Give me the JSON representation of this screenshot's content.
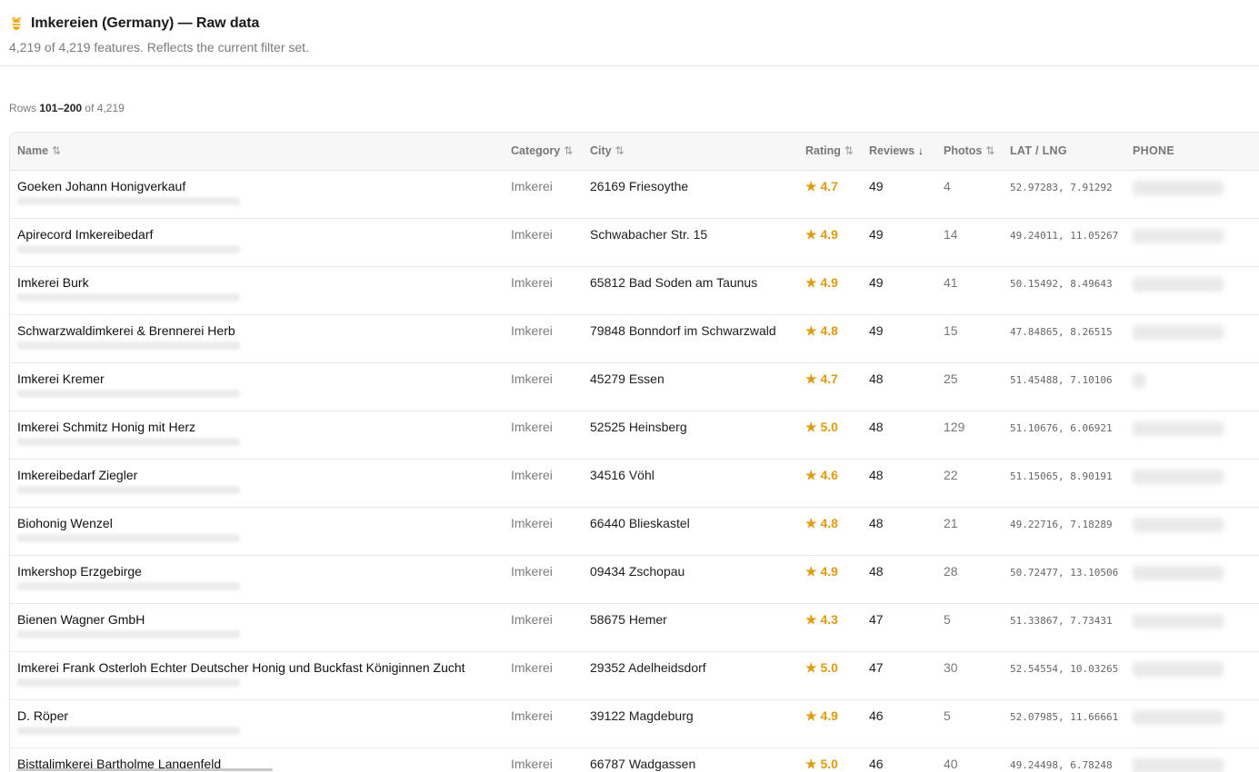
{
  "header": {
    "icon": "bee-icon",
    "title": "Imkereien (Germany) — Raw data",
    "subtitle": "4,219 of 4,219 features. Reflects the current filter set."
  },
  "rows_info": {
    "prefix": "Rows",
    "range": "101–200",
    "of_label": "of",
    "total": "4,219"
  },
  "columns": {
    "name": "Name",
    "category": "Category",
    "city": "City",
    "rating": "Rating",
    "reviews": "Reviews",
    "photos": "Photos",
    "latlng": "LAT / LNG",
    "phone": "PHONE",
    "sort_icon": "⇅",
    "sort_desc_icon": "↓"
  },
  "colors": {
    "rating": "#e39a0c",
    "accent_bee": "#f0a400"
  },
  "rows": [
    {
      "name": "Goeken Johann Honigverkauf",
      "category": "Imkerei",
      "city": "26169 Friesoythe",
      "rating": "★ 4.7",
      "reviews": "49",
      "photos": "4",
      "latlng": "52.97283, 7.91292"
    },
    {
      "name": "Apirecord Imkereibedarf",
      "category": "Imkerei",
      "city": "Schwabacher Str. 15",
      "rating": "★ 4.9",
      "reviews": "49",
      "photos": "14",
      "latlng": "49.24011, 11.05267"
    },
    {
      "name": "Imkerei Burk",
      "category": "Imkerei",
      "city": "65812 Bad Soden am Taunus",
      "rating": "★ 4.9",
      "reviews": "49",
      "photos": "41",
      "latlng": "50.15492, 8.49643"
    },
    {
      "name": "Schwarzwaldimkerei & Brennerei Herb",
      "category": "Imkerei",
      "city": "79848 Bonndorf im Schwarzwald",
      "rating": "★ 4.8",
      "reviews": "49",
      "photos": "15",
      "latlng": "47.84865, 8.26515"
    },
    {
      "name": "Imkerei Kremer",
      "category": "Imkerei",
      "city": "45279 Essen",
      "rating": "★ 4.7",
      "reviews": "48",
      "photos": "25",
      "latlng": "51.45488, 7.10106"
    },
    {
      "name": "Imkerei Schmitz Honig mit Herz",
      "category": "Imkerei",
      "city": "52525 Heinsberg",
      "rating": "★ 5.0",
      "reviews": "48",
      "photos": "129",
      "latlng": "51.10676, 6.06921"
    },
    {
      "name": "Imkereibedarf Ziegler",
      "category": "Imkerei",
      "city": "34516 Vöhl",
      "rating": "★ 4.6",
      "reviews": "48",
      "photos": "22",
      "latlng": "51.15065, 8.90191"
    },
    {
      "name": "Biohonig Wenzel",
      "category": "Imkerei",
      "city": "66440 Blieskastel",
      "rating": "★ 4.8",
      "reviews": "48",
      "photos": "21",
      "latlng": "49.22716, 7.18289"
    },
    {
      "name": "Imkershop Erzgebirge",
      "category": "Imkerei",
      "city": "09434 Zschopau",
      "rating": "★ 4.9",
      "reviews": "48",
      "photos": "28",
      "latlng": "50.72477, 13.10506"
    },
    {
      "name": "Bienen Wagner GmbH",
      "category": "Imkerei",
      "city": "58675 Hemer",
      "rating": "★ 4.3",
      "reviews": "47",
      "photos": "5",
      "latlng": "51.33867, 7.73431"
    },
    {
      "name": "Imkerei Frank Osterloh Echter Deutscher Honig und Buckfast Königinnen Zucht",
      "category": "Imkerei",
      "city": "29352 Adelheidsdorf",
      "rating": "★ 5.0",
      "reviews": "47",
      "photos": "30",
      "latlng": "52.54554, 10.03265"
    },
    {
      "name": "D. Röper",
      "category": "Imkerei",
      "city": "39122 Magdeburg",
      "rating": "★ 4.9",
      "reviews": "46",
      "photos": "5",
      "latlng": "52.07985, 11.66661"
    },
    {
      "name": "Bisttalimkerei Bartholme Langenfeld",
      "category": "Imkerei",
      "city": "66787 Wadgassen",
      "rating": "★ 5.0",
      "reviews": "46",
      "photos": "40",
      "latlng": "49.24498, 6.78248"
    }
  ]
}
